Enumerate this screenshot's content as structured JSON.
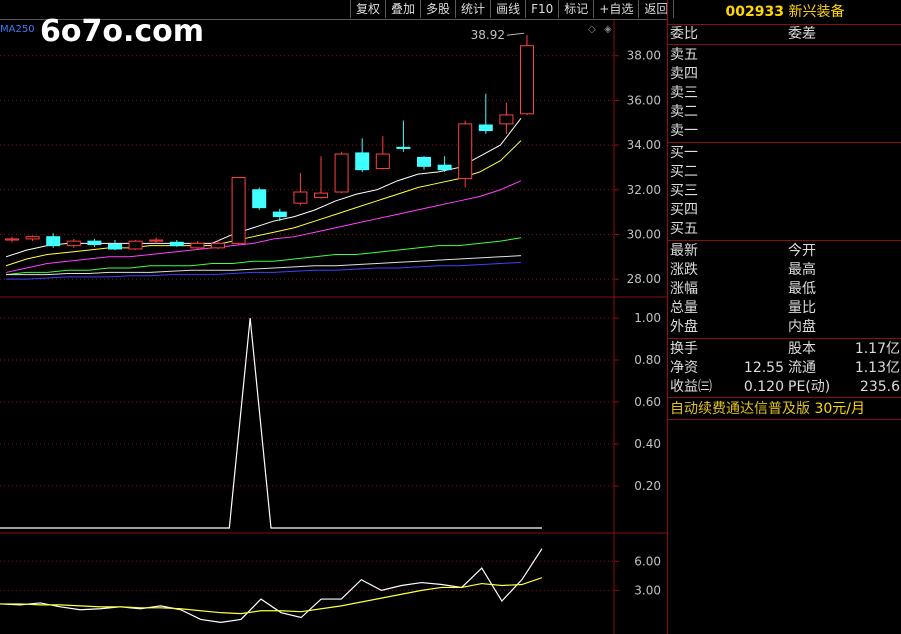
{
  "toolbar": {
    "buttons": [
      "复权",
      "叠加",
      "多股",
      "统计",
      "画线",
      "F10",
      "标记",
      "+自选",
      "返回"
    ]
  },
  "watermark": "6o7o.com",
  "indicator_label": "MA250",
  "chart_data": [
    {
      "type": "candlestick",
      "title": "",
      "y_ticks": [
        "38.00",
        "36.00",
        "34.00",
        "32.00",
        "30.00",
        "28.00"
      ],
      "ylim": [
        27.2,
        39.6
      ],
      "annotation": "38.92",
      "candles": [
        {
          "o": 29.75,
          "h": 29.9,
          "l": 29.65,
          "c": 29.8,
          "up": true
        },
        {
          "o": 29.8,
          "h": 29.95,
          "l": 29.7,
          "c": 29.9,
          "up": true
        },
        {
          "o": 29.9,
          "h": 30.05,
          "l": 29.4,
          "c": 29.5,
          "up": false
        },
        {
          "o": 29.5,
          "h": 29.8,
          "l": 29.4,
          "c": 29.7,
          "up": true
        },
        {
          "o": 29.7,
          "h": 29.8,
          "l": 29.45,
          "c": 29.55,
          "up": false
        },
        {
          "o": 29.55,
          "h": 29.75,
          "l": 29.3,
          "c": 29.35,
          "up": false
        },
        {
          "o": 29.35,
          "h": 29.75,
          "l": 29.3,
          "c": 29.7,
          "up": true
        },
        {
          "o": 29.7,
          "h": 29.85,
          "l": 29.6,
          "c": 29.75,
          "up": true
        },
        {
          "o": 29.65,
          "h": 29.75,
          "l": 29.45,
          "c": 29.5,
          "up": false
        },
        {
          "o": 29.4,
          "h": 29.7,
          "l": 29.3,
          "c": 29.6,
          "up": true
        },
        {
          "o": 29.4,
          "h": 29.75,
          "l": 29.35,
          "c": 29.6,
          "up": true
        },
        {
          "o": 29.6,
          "h": 32.55,
          "l": 29.55,
          "c": 32.55,
          "up": true
        },
        {
          "o": 32.0,
          "h": 32.1,
          "l": 31.1,
          "c": 31.2,
          "up": false
        },
        {
          "o": 31.0,
          "h": 31.15,
          "l": 30.6,
          "c": 30.8,
          "up": false
        },
        {
          "o": 31.4,
          "h": 32.75,
          "l": 31.3,
          "c": 31.9,
          "up": true
        },
        {
          "o": 31.65,
          "h": 33.5,
          "l": 31.6,
          "c": 31.85,
          "up": true
        },
        {
          "o": 31.9,
          "h": 33.7,
          "l": 31.85,
          "c": 33.6,
          "up": true
        },
        {
          "o": 33.65,
          "h": 34.3,
          "l": 32.8,
          "c": 32.9,
          "up": false
        },
        {
          "o": 32.95,
          "h": 34.4,
          "l": 32.9,
          "c": 33.6,
          "up": true
        },
        {
          "o": 33.9,
          "h": 35.1,
          "l": 33.7,
          "c": 33.85,
          "up": false
        },
        {
          "o": 33.45,
          "h": 33.5,
          "l": 32.9,
          "c": 33.05,
          "up": false
        },
        {
          "o": 33.1,
          "h": 33.5,
          "l": 32.8,
          "c": 32.9,
          "up": false
        },
        {
          "o": 32.5,
          "h": 35.1,
          "l": 32.1,
          "c": 34.95,
          "up": true
        },
        {
          "o": 34.9,
          "h": 36.3,
          "l": 34.5,
          "c": 34.65,
          "up": false
        },
        {
          "o": 34.95,
          "h": 35.9,
          "l": 34.5,
          "c": 35.35,
          "up": true
        },
        {
          "o": 35.4,
          "h": 38.92,
          "l": 35.35,
          "c": 38.45,
          "up": true
        }
      ],
      "ma_lines": [
        {
          "color": "#ffffff",
          "values": [
            29.0,
            29.3,
            29.5,
            29.6,
            29.6,
            29.6,
            29.6,
            29.6,
            29.6,
            29.6,
            29.6,
            30.0,
            30.3,
            30.6,
            30.8,
            31.1,
            31.5,
            31.8,
            32.0,
            32.4,
            32.7,
            32.8,
            33.0,
            33.5,
            34.0,
            35.2
          ]
        },
        {
          "color": "#ffff40",
          "values": [
            28.6,
            28.9,
            29.1,
            29.2,
            29.3,
            29.4,
            29.4,
            29.5,
            29.5,
            29.5,
            29.5,
            29.7,
            29.9,
            30.1,
            30.3,
            30.6,
            30.9,
            31.2,
            31.5,
            31.8,
            32.1,
            32.3,
            32.5,
            32.8,
            33.3,
            34.2
          ]
        },
        {
          "color": "#ff40ff",
          "values": [
            28.3,
            28.5,
            28.7,
            28.8,
            28.9,
            29.0,
            29.0,
            29.1,
            29.2,
            29.3,
            29.4,
            29.5,
            29.6,
            29.8,
            29.9,
            30.1,
            30.3,
            30.5,
            30.7,
            30.9,
            31.1,
            31.3,
            31.5,
            31.7,
            32.0,
            32.4
          ]
        },
        {
          "color": "#40ff40",
          "values": [
            28.2,
            28.3,
            28.3,
            28.4,
            28.4,
            28.5,
            28.5,
            28.6,
            28.6,
            28.6,
            28.7,
            28.7,
            28.8,
            28.8,
            28.9,
            29.0,
            29.1,
            29.1,
            29.2,
            29.3,
            29.4,
            29.5,
            29.5,
            29.6,
            29.7,
            29.85
          ]
        },
        {
          "color": "#e0e0e0",
          "values": [
            28.2,
            28.2,
            28.2,
            28.25,
            28.25,
            28.3,
            28.3,
            28.3,
            28.35,
            28.4,
            28.4,
            28.4,
            28.45,
            28.5,
            28.55,
            28.6,
            28.6,
            28.65,
            28.7,
            28.75,
            28.8,
            28.85,
            28.9,
            28.95,
            29.0,
            29.05
          ]
        },
        {
          "color": "#4040ff",
          "values": [
            28.0,
            28.0,
            28.05,
            28.1,
            28.1,
            28.1,
            28.15,
            28.15,
            28.2,
            28.2,
            28.2,
            28.25,
            28.3,
            28.3,
            28.35,
            28.4,
            28.4,
            28.45,
            28.5,
            28.5,
            28.55,
            28.6,
            28.6,
            28.65,
            28.7,
            28.75
          ]
        }
      ]
    },
    {
      "type": "line",
      "title": "",
      "y_ticks": [
        "1.00",
        "0.80",
        "0.60",
        "0.40",
        "0.20"
      ],
      "ylim": [
        0,
        1.0
      ],
      "series": [
        {
          "color": "#ffffff",
          "values": [
            0,
            0,
            0,
            0,
            0,
            0,
            0,
            0,
            0,
            0,
            0,
            0,
            1.0,
            0,
            0,
            0,
            0,
            0,
            0,
            0,
            0,
            0,
            0,
            0,
            0,
            0,
            0
          ]
        }
      ]
    },
    {
      "type": "line",
      "title": "",
      "y_ticks": [
        "6.00",
        "3.00"
      ],
      "ylim": [
        -1.5,
        8.5
      ],
      "series": [
        {
          "color": "#ffffff",
          "values": [
            1.6,
            1.5,
            1.7,
            1.3,
            1.0,
            1.1,
            1.3,
            1.1,
            1.4,
            1.0,
            0.0,
            -0.3,
            0.0,
            2.1,
            0.7,
            0.2,
            2.1,
            2.1,
            4.1,
            3.0,
            3.5,
            3.8,
            3.6,
            3.3,
            5.3,
            1.9,
            4.1,
            7.3
          ]
        },
        {
          "color": "#ffff40",
          "values": [
            1.6,
            1.6,
            1.5,
            1.5,
            1.4,
            1.3,
            1.3,
            1.2,
            1.2,
            1.1,
            0.9,
            0.7,
            0.6,
            0.9,
            0.9,
            0.8,
            1.1,
            1.4,
            1.8,
            2.2,
            2.6,
            3.0,
            3.3,
            3.3,
            3.7,
            3.5,
            3.6,
            4.3
          ]
        }
      ]
    }
  ],
  "panel": {
    "code": "002933",
    "name": "新兴装备",
    "header_row": {
      "left": "委比",
      "right": "委差"
    },
    "sell_levels": [
      "卖五",
      "卖四",
      "卖三",
      "卖二",
      "卖一"
    ],
    "buy_levels": [
      "买一",
      "买二",
      "买三",
      "买四",
      "买五"
    ],
    "quote_rows": [
      {
        "left": "最新",
        "right": "今开"
      },
      {
        "left": "涨跌",
        "right": "最高"
      },
      {
        "left": "涨幅",
        "right": "最低"
      },
      {
        "left": "总量",
        "right": "量比"
      },
      {
        "left": "外盘",
        "right": "内盘"
      }
    ],
    "finance_rows": [
      {
        "left": "换手",
        "left_value": "",
        "right": "股本",
        "right_value": "1.17亿"
      },
      {
        "left": "净资",
        "left_value": "12.55",
        "right": "流通",
        "right_value": "1.13亿"
      },
      {
        "left": "收益㈢",
        "left_value": "0.120",
        "right": "PE(动)",
        "right_value": "235.6"
      }
    ],
    "ad_text": "自动续费通达信普及版",
    "ad_price": "30元/月"
  }
}
